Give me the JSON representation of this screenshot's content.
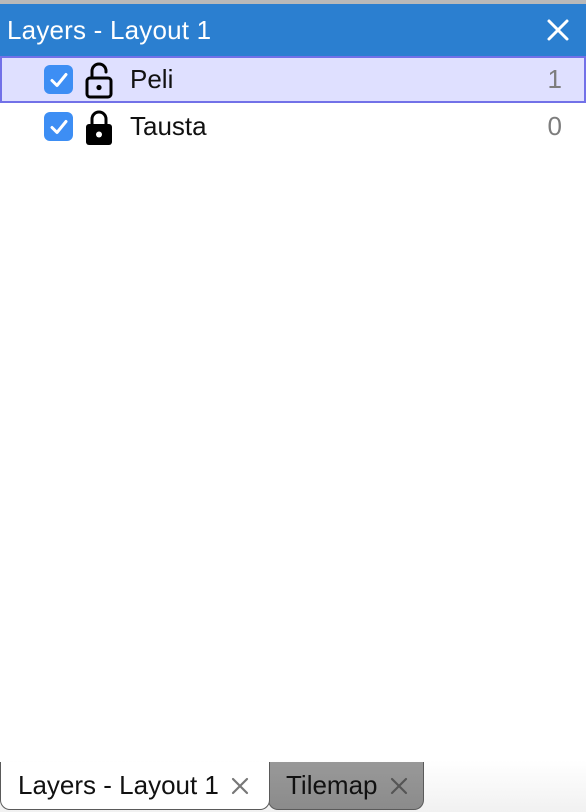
{
  "panel": {
    "title": "Layers - Layout 1"
  },
  "layers": [
    {
      "name": "Peli",
      "count": "1",
      "visible": true,
      "locked": false,
      "selected": true
    },
    {
      "name": "Tausta",
      "count": "0",
      "visible": true,
      "locked": true,
      "selected": false
    }
  ],
  "tabs": [
    {
      "label": "Layers - Layout 1",
      "active": true
    },
    {
      "label": "Tilemap",
      "active": false
    }
  ],
  "colors": {
    "titlebar": "#2b7fd0",
    "selected_row": "#dfe0ff",
    "selected_border": "#7271e8",
    "checkbox": "#3d8ef4"
  },
  "icons": {
    "close": "close-icon",
    "checkbox": "checkmark-icon",
    "unlocked": "lock-open-icon",
    "locked": "lock-closed-icon"
  }
}
